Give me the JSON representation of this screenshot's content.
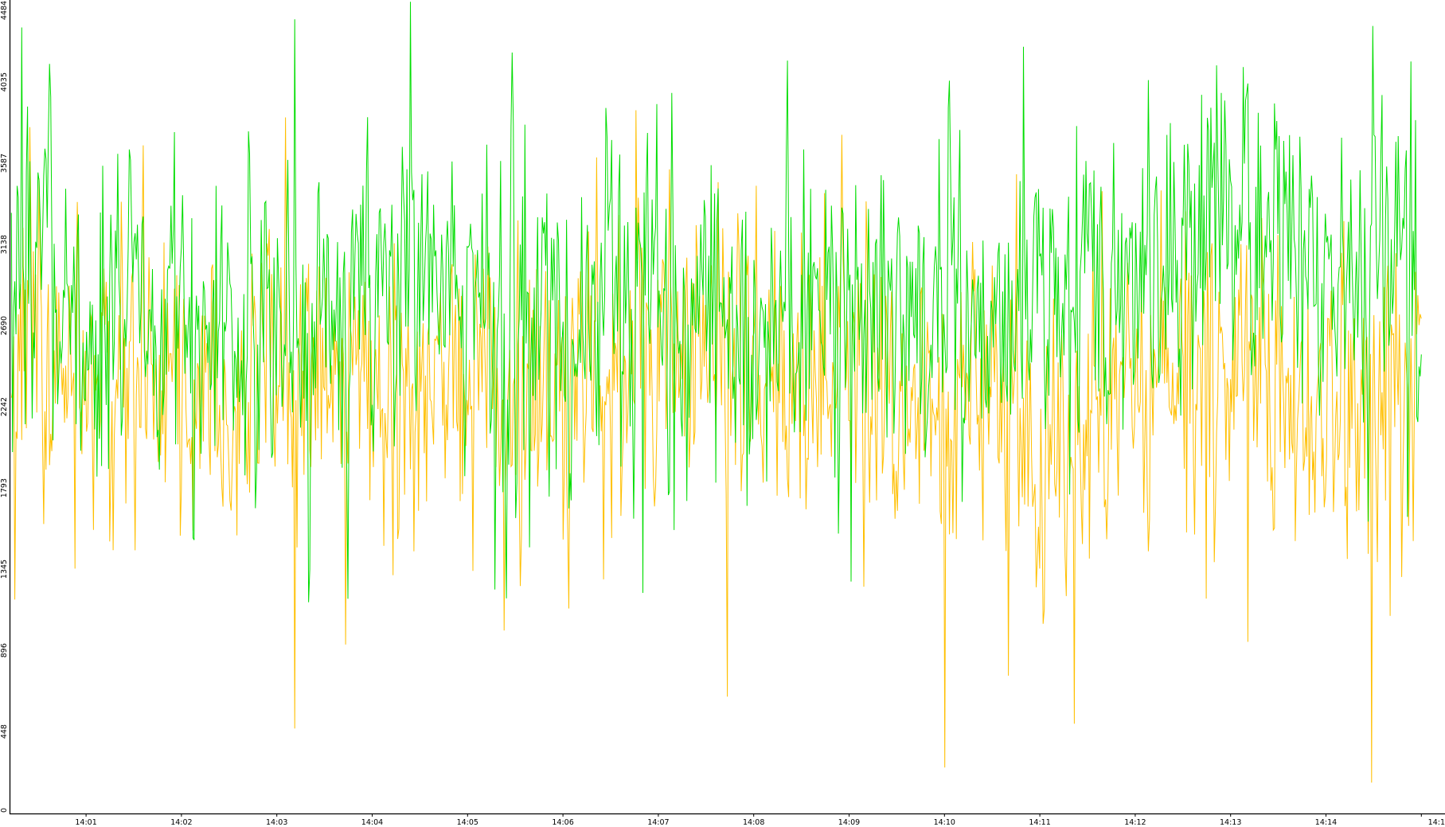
{
  "chart_data": {
    "type": "line",
    "title": "",
    "xlabel": "",
    "ylabel": "",
    "x_start": "14:00:13",
    "x_end": "14:15:00",
    "sample_count": 1220,
    "x_ticks": [
      "14:01",
      "14:02",
      "14:03",
      "14:04",
      "14:05",
      "14:06",
      "14:07",
      "14:08",
      "14:09",
      "14:10",
      "14:11",
      "14:12",
      "14:13",
      "14:14",
      "14:1"
    ],
    "y_ticks": [
      0,
      448,
      896,
      1345,
      1793,
      2242,
      2690,
      3138,
      3587,
      4035,
      4484
    ],
    "ylim": [
      0,
      4484
    ],
    "grid": false,
    "legend": "none",
    "series": [
      {
        "color": "#00dd00",
        "profile_times": [
          "14:00:13",
          "14:01:00",
          "14:02:00",
          "14:03:00",
          "14:04:00",
          "14:05:00",
          "14:06:00",
          "14:07:00",
          "14:08:00",
          "14:09:00",
          "14:10:00",
          "14:11:00",
          "14:12:00",
          "14:12:30",
          "14:13:00",
          "14:14:00",
          "14:15:00"
        ],
        "profile_values": [
          3000,
          2750,
          2600,
          2800,
          2850,
          2850,
          2650,
          2800,
          2600,
          2900,
          2700,
          2850,
          2900,
          2950,
          3250,
          2950,
          2900
        ],
        "min": 1100,
        "max": 4484
      },
      {
        "color": "#ffbf00",
        "profile_times": [
          "14:00:13",
          "14:01:00",
          "14:02:00",
          "14:03:00",
          "14:04:00",
          "14:05:00",
          "14:06:00",
          "14:07:00",
          "14:08:00",
          "14:09:00",
          "14:10:00",
          "14:11:00",
          "14:12:00",
          "14:12:30",
          "14:13:00",
          "14:14:00",
          "14:15:00"
        ],
        "profile_values": [
          2550,
          2400,
          2250,
          2450,
          2500,
          2450,
          2200,
          2550,
          2350,
          2550,
          2250,
          2100,
          2200,
          2350,
          2600,
          2200,
          2300
        ],
        "min": 0,
        "max": 4000
      }
    ]
  }
}
